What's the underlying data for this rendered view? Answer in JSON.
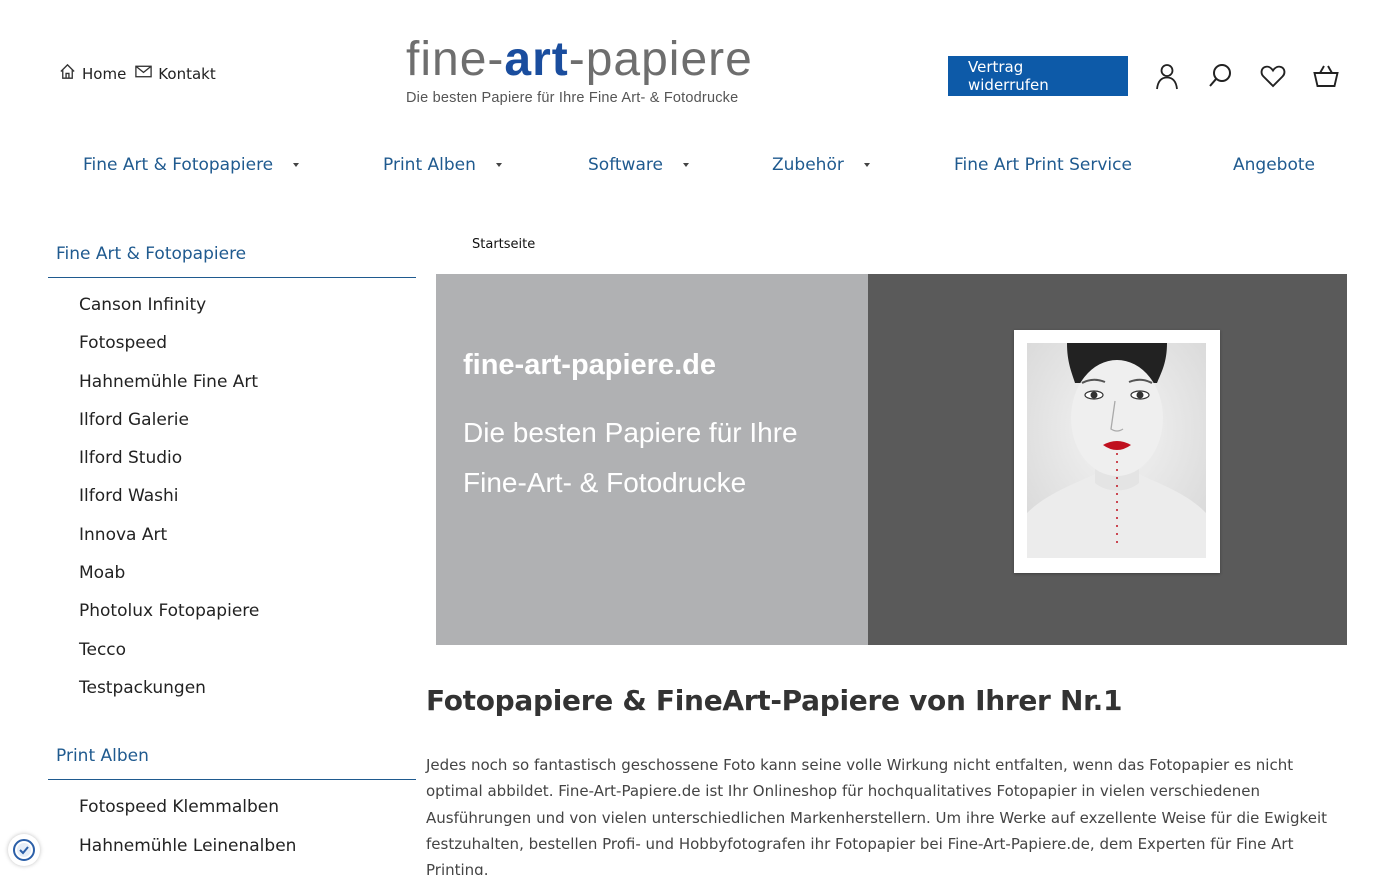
{
  "top_links": [
    {
      "label": "Home",
      "icon": "home-icon"
    },
    {
      "label": "Kontakt",
      "icon": "mail-icon"
    }
  ],
  "logo": {
    "part1": "fine-",
    "part2": "art",
    "part3": "-papiere",
    "tagline": "Die besten Papiere für Ihre Fine Art- & Fotodrucke",
    "accent_color": "#1a4d9e"
  },
  "header": {
    "revoke_button": "Vertrag widerrufen",
    "icons": [
      "user-icon",
      "search-icon",
      "heart-icon",
      "basket-icon"
    ]
  },
  "main_nav": [
    {
      "label": "Fine Art & Fotopapiere",
      "has_dropdown": true
    },
    {
      "label": "Print Alben",
      "has_dropdown": true
    },
    {
      "label": "Software",
      "has_dropdown": true
    },
    {
      "label": "Zubehör",
      "has_dropdown": true
    },
    {
      "label": "Fine Art Print Service",
      "has_dropdown": false
    },
    {
      "label": "Angebote",
      "has_dropdown": false
    }
  ],
  "sidebar": {
    "sections": [
      {
        "heading": "Fine Art & Fotopapiere",
        "items": [
          "Canson Infinity",
          "Fotospeed",
          "Hahnemühle Fine Art",
          "Ilford Galerie",
          "Ilford Studio",
          "Ilford Washi",
          "Innova Art",
          "Moab",
          "Photolux Fotopapiere",
          "Tecco",
          "Testpackungen"
        ]
      },
      {
        "heading": "Print Alben",
        "items": [
          "Fotospeed Klemmalben",
          "Hahnemühle Leinenalben"
        ]
      }
    ]
  },
  "breadcrumb": "Startseite",
  "hero": {
    "title": "fine-art-papiere.de",
    "line1": "Die besten Papiere für Ihre",
    "line2": "Fine-Art- & Fotodrucke"
  },
  "content": {
    "title": "Fotopapiere & FineArt-Papiere von Ihrer Nr.1",
    "text": "Jedes noch so fantastisch geschossene Foto kann seine volle Wirkung nicht entfalten, wenn das Fotopapier es nicht optimal abbildet. Fine-Art-Papiere.de ist Ihr Onlineshop für hochqualitatives Fotopapier in vielen verschiedenen Ausführungen und von vielen unterschiedlichen Markenherstellern. Um ihre Werke auf exzellente Weise für die Ewigkeit festzuhalten, bestellen Profi- und Hobbyfotografen ihr Fotopapier bei Fine-Art-Papiere.de, dem Experten für Fine Art Printing."
  },
  "colors": {
    "nav_blue": "#1f5a8f",
    "button_blue": "#0d5aa8",
    "hero_left_bg": "#b0b1b3",
    "hero_right_bg": "#5a5a5a"
  }
}
